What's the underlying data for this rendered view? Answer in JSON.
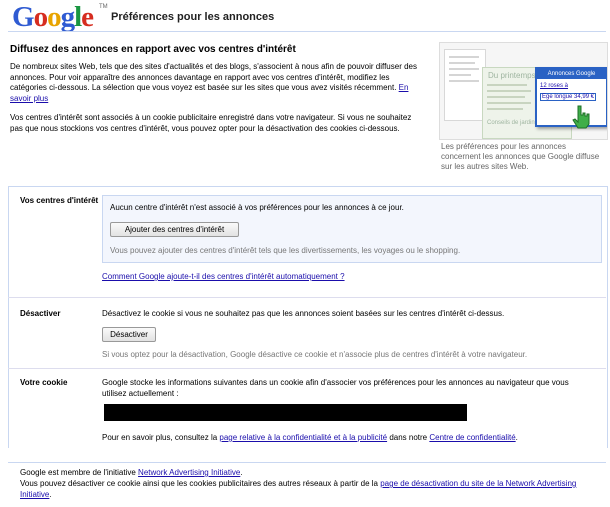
{
  "header": {
    "logo": "Google",
    "trademark": "TM",
    "title": "Préférences pour les annonces"
  },
  "intro": {
    "heading": "Diffusez des annonces en rapport avec vos centres d'intérêt",
    "p1": "De nombreux sites Web, tels que des sites d'actualités et des blogs, s'associent à nous afin de pouvoir diffuser des annonces. Pour voir apparaître des annonces davantage en rapport avec vos centres d'intérêt, modifiez les catégories ci-dessous. La sélection que vous voyez est basée sur les sites que vous avez visités récemment.",
    "learn_more": "En savoir plus",
    "p2": "Vos centres d'intérêt sont associés à un cookie publicitaire enregistré dans votre navigateur. Si vous ne souhaitez pas que nous stockions vos centres d'intérêt, vous pouvez opter pour la désactivation des cookies ci-dessous."
  },
  "illustration": {
    "heading": "Du printemps à",
    "ad_title": "Annonces Google",
    "ad_line1": "12 roses à",
    "ad_line2": "Ege longue 34,99 €",
    "bottom_text": "Conseils de jardin",
    "caption": "Les préférences pour les annonces concernent les annonces que Google diffuse sur les autres sites Web."
  },
  "sections": {
    "interests": {
      "label": "Vos centres d'intérêt",
      "status": "Aucun centre d'intérêt n'est associé à vos préférences pour les annonces à ce jour.",
      "add_button": "Ajouter des centres d'intérêt",
      "hint": "Vous pouvez ajouter des centres d'intérêt tels que les divertissements, les voyages ou le shopping.",
      "auto_link": "Comment Google ajoute-t-il des centres d'intérêt automatiquement ?"
    },
    "deactivate": {
      "label": "Désactiver",
      "text": "Désactivez le cookie si vous ne souhaitez pas que les annonces soient basées sur les centres d'intérêt ci-dessus.",
      "button": "Désactiver",
      "note": "Si vous optez pour la désactivation, Google désactive ce cookie et n'associe plus de centres d'intérêt à votre navigateur."
    },
    "cookie": {
      "label": "Votre cookie",
      "text": "Google stocke les informations suivantes dans un cookie afin d'associer vos préférences pour les annonces au navigateur que vous utilisez actuellement :",
      "more_prefix": "Pour en savoir plus, consultez la",
      "privacy_link": "page relative à la confidentialité et à la publicité",
      "more_middle": "dans notre",
      "center_link": "Centre de confidentialité",
      "more_suffix": "."
    }
  },
  "footer": {
    "line1_prefix": "Google est membre de l'initiative",
    "nai_link": "Network Advertising Initiative",
    "line1_suffix": ".",
    "line2_prefix": "Vous pouvez désactiver ce cookie ainsi que les cookies publicitaires des autres réseaux à partir de la",
    "optout_link": "page de désactivation du site de la Network Advertising Initiative",
    "line2_suffix": "."
  },
  "colors": {
    "link": "#1a0dab",
    "rule": "#c9d7f1",
    "panel": "#f3f6fd",
    "ad_accent": "#2a62c4"
  }
}
